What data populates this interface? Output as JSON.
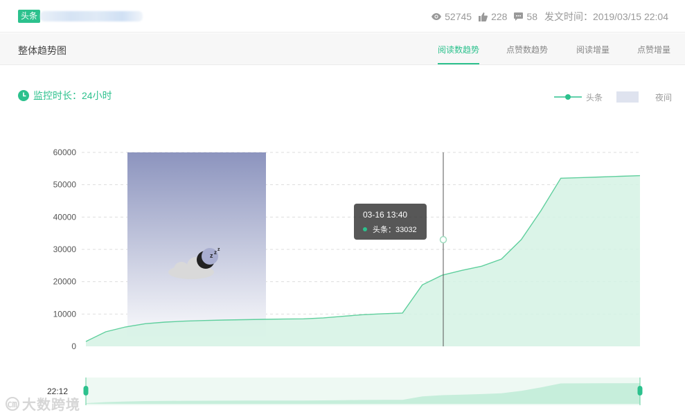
{
  "header": {
    "platform_badge": "头条",
    "views": "52745",
    "likes": "228",
    "comments": "58",
    "publish_time": "发文时间：2019/03/15 22:04"
  },
  "tabbar": {
    "title": "整体趋势图",
    "tabs": [
      {
        "label": "阅读数趋势",
        "active": true
      },
      {
        "label": "点赞数趋势",
        "active": false
      },
      {
        "label": "阅读增量",
        "active": false
      },
      {
        "label": "点赞增量",
        "active": false
      }
    ]
  },
  "monitor": {
    "label": "监控时长：24小时"
  },
  "legend": {
    "series": "头条",
    "night": "夜间"
  },
  "colors": {
    "accent": "#2cc18d",
    "night_top": "#8c94be",
    "area": "#d5f2e4"
  },
  "tooltip": {
    "time": "03-16 13:40",
    "label": "头条：33032"
  },
  "slider": {
    "start_label": "22:12"
  },
  "watermark": "大数跨境",
  "chart_data": {
    "type": "area",
    "series": [
      {
        "name": "头条",
        "values": [
          1500,
          4500,
          6000,
          7000,
          7500,
          7800,
          8000,
          8150,
          8250,
          8350,
          8450,
          8500,
          8800,
          9300,
          9800,
          10100,
          10300,
          19000,
          22000,
          23500,
          24800,
          27000,
          33032,
          42000,
          52000,
          52200,
          52400,
          52600,
          52800
        ]
      }
    ],
    "ylim": [
      0,
      60000
    ],
    "yticks": [
      "0",
      "10000",
      "20000",
      "30000",
      "40000",
      "50000",
      "60000"
    ],
    "grid": true,
    "night_band": true,
    "legend_position": "top-right"
  }
}
